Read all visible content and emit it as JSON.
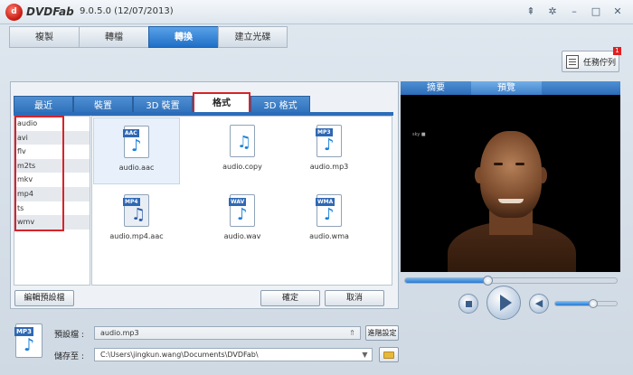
{
  "titlebar": {
    "logo_text": "d",
    "app_name": "DVDFab",
    "version": "9.0.5.0 (12/07/2013)",
    "buttons": [
      "pin-icon",
      "settings-icon",
      "minimize-icon",
      "maximize-icon",
      "close-icon"
    ]
  },
  "main_tabs": [
    {
      "label": "複製",
      "active": false
    },
    {
      "label": "轉檔",
      "active": false
    },
    {
      "label": "轉換",
      "active": true
    },
    {
      "label": "建立光碟",
      "active": false
    }
  ],
  "task_queue": {
    "label": "任務佇列",
    "badge": "1"
  },
  "sub_tabs": [
    {
      "label": "最近",
      "active": false
    },
    {
      "label": "裝置",
      "active": false
    },
    {
      "label": "3D 裝置",
      "active": false
    },
    {
      "label": "格式",
      "active": true
    },
    {
      "label": "3D 格式",
      "active": false
    }
  ],
  "format_list": [
    "audio",
    "avi",
    "flv",
    "m2ts",
    "mkv",
    "mp4",
    "ts",
    "wmv"
  ],
  "profiles": [
    {
      "tag": "AAC",
      "label": "audio.aac",
      "selected": true
    },
    {
      "tag": "",
      "label": "audio.copy",
      "selected": false
    },
    {
      "tag": "MP3",
      "label": "audio.mp3",
      "selected": false
    },
    {
      "tag": "MP4",
      "label": "audio.mp4.aac",
      "selected": false
    },
    {
      "tag": "WAV",
      "label": "audio.wav",
      "selected": false
    },
    {
      "tag": "WMA",
      "label": "audio.wma",
      "selected": false
    }
  ],
  "buttons": {
    "edit_profile": "編輯預設檔",
    "confirm": "確定",
    "cancel": "取消",
    "advanced": "進階設定"
  },
  "preview": {
    "tabs": [
      {
        "label": "摘要",
        "active": false
      },
      {
        "label": "預覽",
        "active": true
      }
    ],
    "stamp": "sky ■",
    "seek_position": 0.39,
    "volume": 0.62
  },
  "bottom": {
    "profile_icon_tag": "MP3",
    "profile_label": "預設檔 :",
    "profile_value": "audio.mp3",
    "save_label": "儲存至 :",
    "save_path": "C:\\Users\\jingkun.wang\\Documents\\DVDFab\\"
  }
}
